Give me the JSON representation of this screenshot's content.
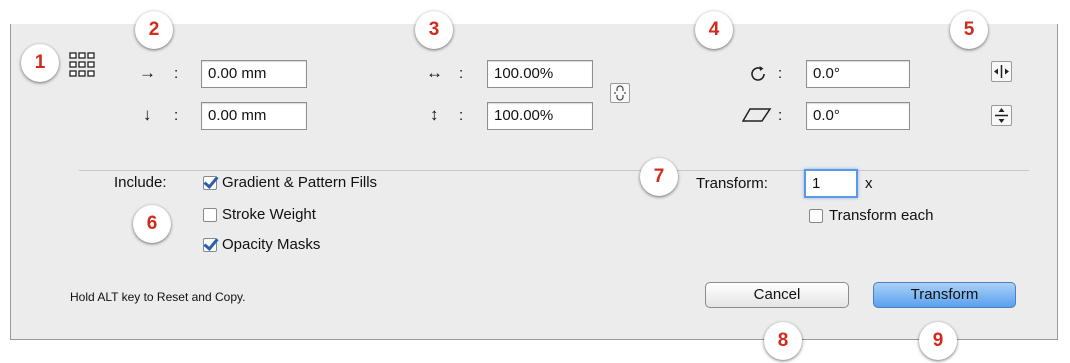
{
  "move": {
    "horizontal_symbol": "→",
    "vertical_symbol": "↓",
    "horizontal_value": "0.00 mm",
    "vertical_value": "0.00 mm",
    "colon": ":"
  },
  "scale": {
    "horizontal_symbol": "↔",
    "vertical_symbol": "↕",
    "horizontal_value": "100.00%",
    "vertical_value": "100.00%"
  },
  "rotate": {
    "rotate_value": "0.0°",
    "shear_value": "0.0°"
  },
  "include": {
    "label": "Include:",
    "options": [
      {
        "label": "Gradient & Pattern Fills",
        "checked": true
      },
      {
        "label": "Stroke Weight",
        "checked": false
      },
      {
        "label": "Opacity Masks",
        "checked": true
      }
    ]
  },
  "transform": {
    "label": "Transform:",
    "count": "1",
    "suffix": "x",
    "each_label": "Transform each",
    "each_checked": false
  },
  "hint": "Hold ALT key to Reset and Copy.",
  "buttons": {
    "cancel": "Cancel",
    "ok": "Transform"
  },
  "markers": [
    "1",
    "2",
    "3",
    "4",
    "5",
    "6",
    "7",
    "8",
    "9"
  ],
  "colors": {
    "marker_text": "#d22b1e",
    "primary_button": "#5aa0ee",
    "dialog_bg": "#ececec"
  }
}
